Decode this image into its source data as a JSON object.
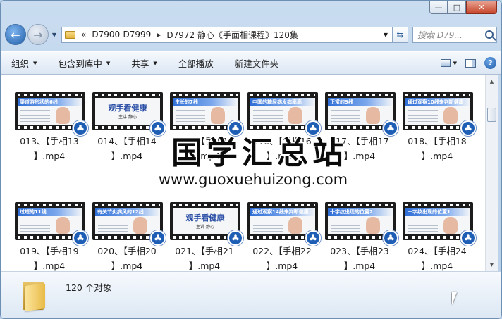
{
  "window": {
    "caption_min": "—",
    "caption_max": "□",
    "caption_close": "✕"
  },
  "address": {
    "chevron": "«",
    "segments": [
      "D7900-D7999",
      "D7972 静心《手面相课程》120集"
    ],
    "search_placeholder": "搜索 D79..."
  },
  "toolbar": {
    "organize": "组织",
    "include_library": "包含到库中",
    "share": "共享",
    "play_all": "全部播放",
    "new_folder": "新建文件夹",
    "help": "?"
  },
  "files": [
    {
      "line1": "013、【手相13",
      "line2": "】.mp4",
      "thumb_text": "渠道游形状的6线",
      "cover": false
    },
    {
      "line1": "014、【手相14",
      "line2": "】.mp4",
      "thumb_text": "观手看健康",
      "cover": true,
      "cover_sub": "主讲 静心"
    },
    {
      "line1": "015、【手相15",
      "line2": "】.mp4",
      "thumb_text": "生长的7线",
      "cover": false
    },
    {
      "line1": "016、【手相16",
      "line2": "】.mp4",
      "thumb_text": "中国的糖尿病发病率高",
      "cover": false
    },
    {
      "line1": "017、【手相17",
      "line2": "】.mp4",
      "thumb_text": "正常的9线",
      "cover": false
    },
    {
      "line1": "018、【手相18",
      "line2": "】.mp4",
      "thumb_text": "通过观察10线来判断健康",
      "cover": false
    },
    {
      "line1": "019、【手相19",
      "line2": "】.mp4",
      "thumb_text": "过短的11线",
      "cover": false
    },
    {
      "line1": "020、【手相20",
      "line2": "】.mp4",
      "thumb_text": "有关节炎病风的12线",
      "cover": false
    },
    {
      "line1": "021、【手相21",
      "line2": "】.mp4",
      "thumb_text": "观手看健康",
      "cover": true,
      "cover_sub": "主讲 静心"
    },
    {
      "line1": "022、【手相22",
      "line2": "】.mp4",
      "thumb_text": "通过观察14线来判断健康",
      "cover": false
    },
    {
      "line1": "023、【手相23",
      "line2": "】.mp4",
      "thumb_text": "十字纹出现的位置2",
      "cover": false
    },
    {
      "line1": "024、【手相24",
      "line2": "】.mp4",
      "thumb_text": "十字纹出现的位置1",
      "cover": false
    }
  ],
  "details": {
    "count": "120 个对象"
  },
  "watermark": {
    "cn": "国学汇总站",
    "en": "www.guoxuehuizong.com"
  }
}
